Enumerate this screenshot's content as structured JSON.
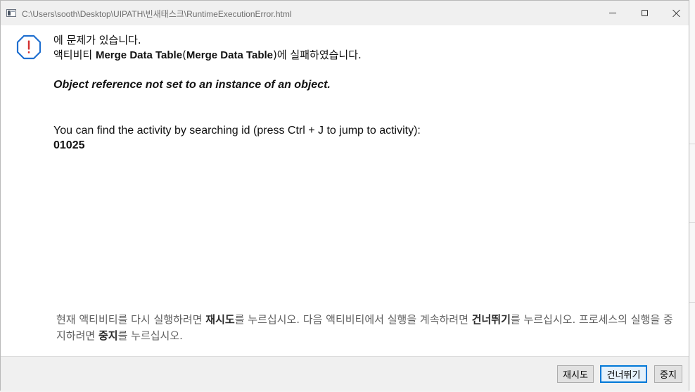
{
  "window": {
    "title": "C:\\Users\\sooth\\Desktop\\UIPATH\\빈새태스크\\RuntimeExecutionError.html",
    "minimize_icon": "minimize-icon",
    "maximize_icon": "maximize-icon",
    "close_icon": "close-icon"
  },
  "error": {
    "icon": "warning-icon",
    "heading": "에 문제가 있습니다.",
    "activity_prefix": "액티비티 ",
    "activity_name": "Merge Data Table",
    "activity_paren_open": "(",
    "activity_display_name": "Merge Data Table",
    "activity_suffix": ")에 실패하였습니다.",
    "message": "Object reference not set to an instance of an object.",
    "find_hint": "You can find the activity by searching id (press Ctrl + J to jump to activity):",
    "activity_id": "01025"
  },
  "instructions": {
    "part1": "현재 액티비티를 다시 실행하려면 ",
    "retry_word": "재시도",
    "part2": "를 누르십시오. 다음 액티비티에서 실행을 계속하려면 ",
    "skip_word": "건너뛰기",
    "part3": "를 누르십시오. 프로세스의 실행을 중지하려면 ",
    "stop_word": "중지",
    "part4": "를 누르십시오."
  },
  "buttons": {
    "retry": "재시도",
    "skip": "건너뛰기",
    "stop": "중지"
  },
  "colors": {
    "icon_blue": "#1f6fd0",
    "icon_red": "#d32f2f",
    "focus_blue": "#0078d7"
  }
}
